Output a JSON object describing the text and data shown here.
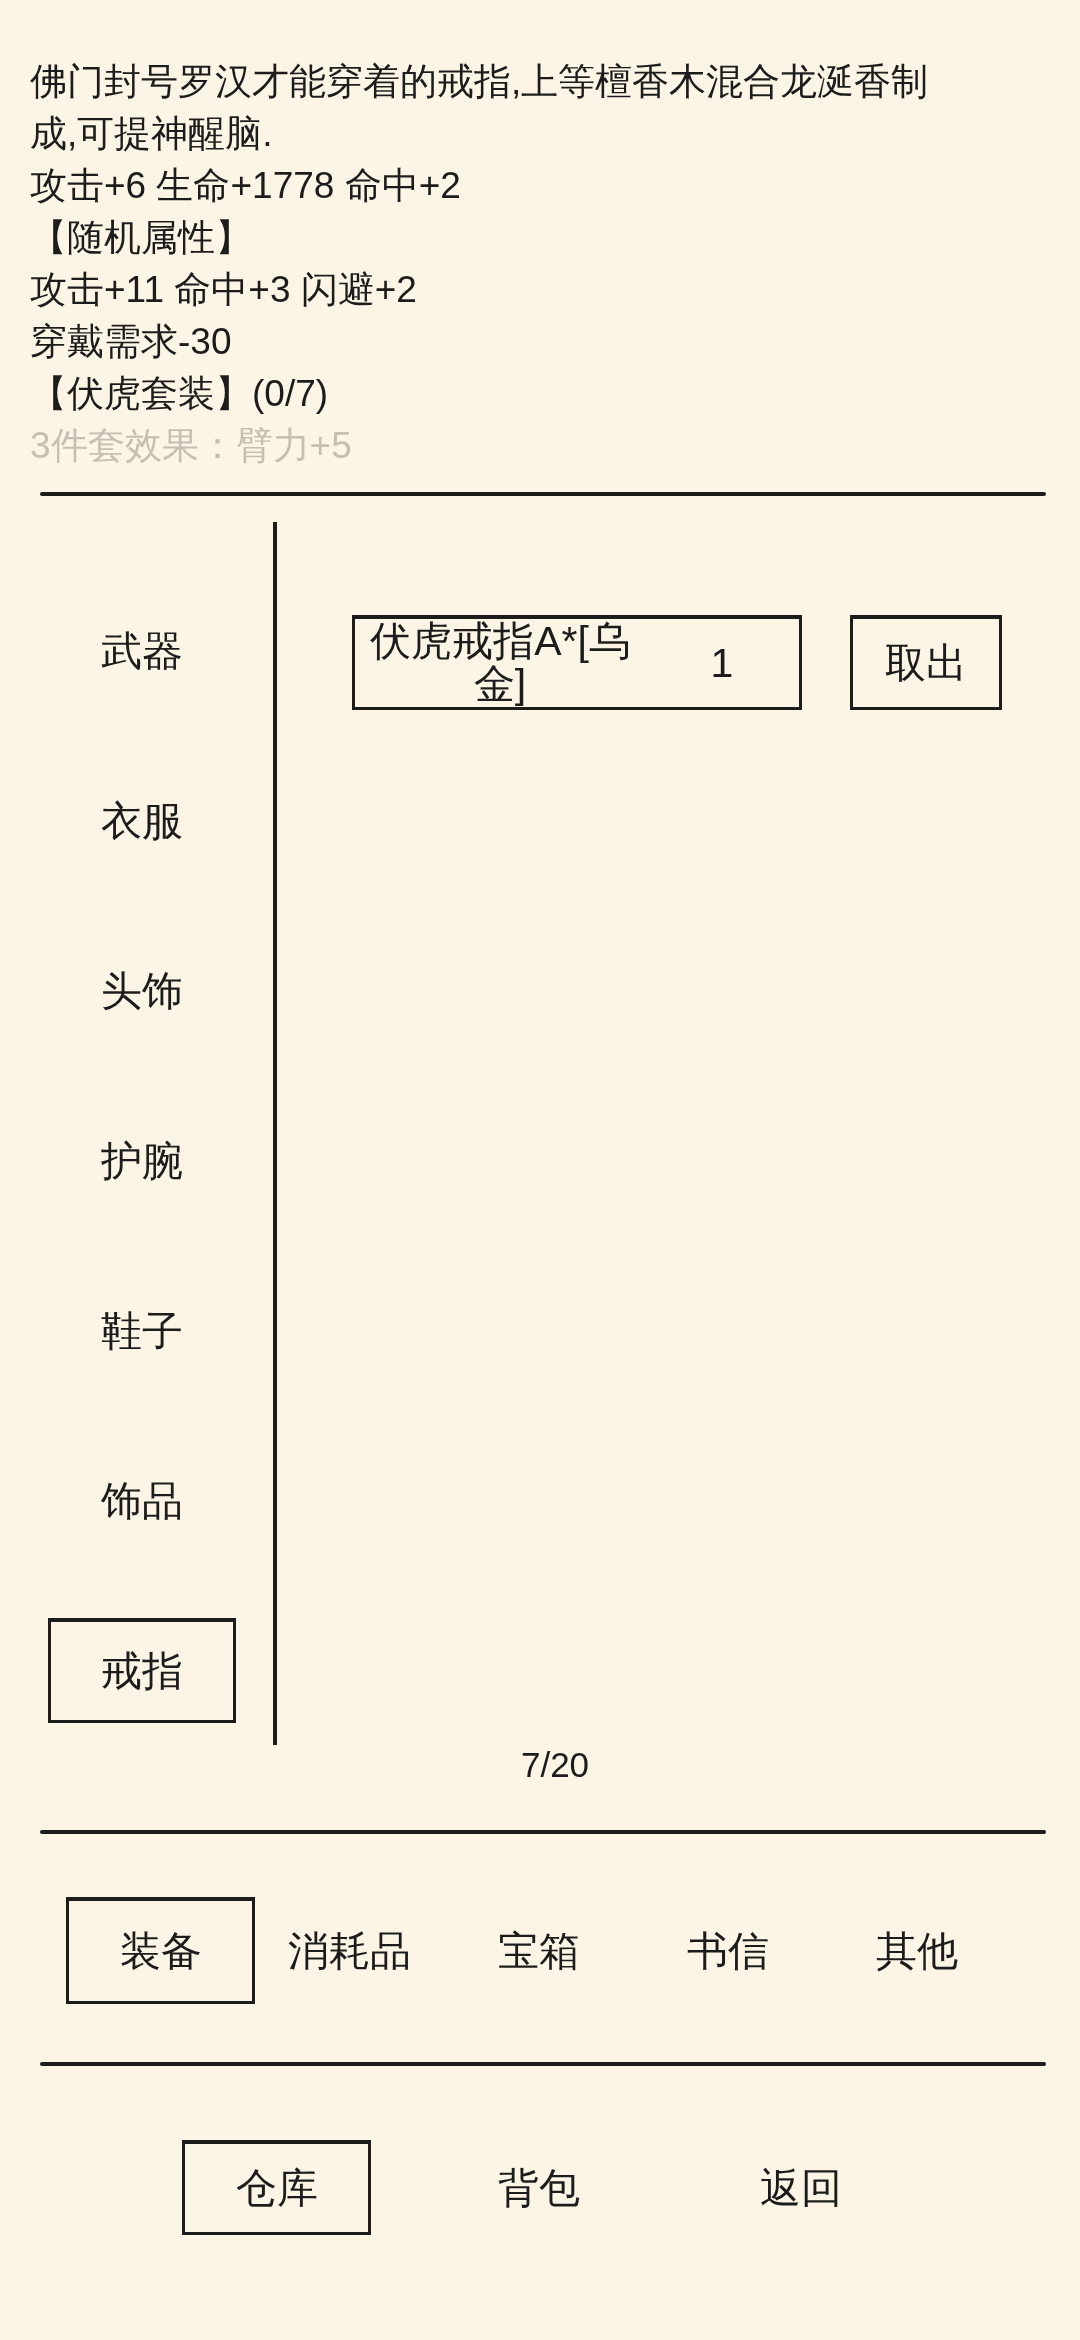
{
  "lines": [
    {
      "text": "佛门封号罗汉才能穿着的戒指,上等檀香木混合龙涎香制成,可提神醒脑.",
      "faded": false
    },
    {
      "text": "攻击+6 生命+1778 命中+2",
      "faded": false
    },
    {
      "text": "【随机属性】",
      "faded": false
    },
    {
      "text": "攻击+11 命中+3 闪避+2",
      "faded": false
    },
    {
      "text": "穿戴需求-30",
      "faded": false
    },
    {
      "text": "【伏虎套装】(0/7)",
      "faded": false
    },
    {
      "text": "3件套效果：臂力+5",
      "faded": true
    }
  ],
  "categories": [
    {
      "label": "武器",
      "selected": false
    },
    {
      "label": "衣服",
      "selected": false
    },
    {
      "label": "头饰",
      "selected": false
    },
    {
      "label": "护腕",
      "selected": false
    },
    {
      "label": "鞋子",
      "selected": false
    },
    {
      "label": "饰品",
      "selected": false
    },
    {
      "label": "戒指",
      "selected": true
    }
  ],
  "items": [
    {
      "name": "伏虎戒指A*[乌金]",
      "count": "1",
      "action": "取出"
    }
  ],
  "page_indicator": "7/20",
  "tabs": [
    {
      "label": "装备",
      "selected": true
    },
    {
      "label": "消耗品",
      "selected": false
    },
    {
      "label": "宝箱",
      "selected": false
    },
    {
      "label": "书信",
      "selected": false
    },
    {
      "label": "其他",
      "selected": false
    }
  ],
  "bottom_nav": [
    {
      "label": "仓库",
      "selected": true
    },
    {
      "label": "背包",
      "selected": false
    },
    {
      "label": "返回",
      "selected": false
    }
  ]
}
